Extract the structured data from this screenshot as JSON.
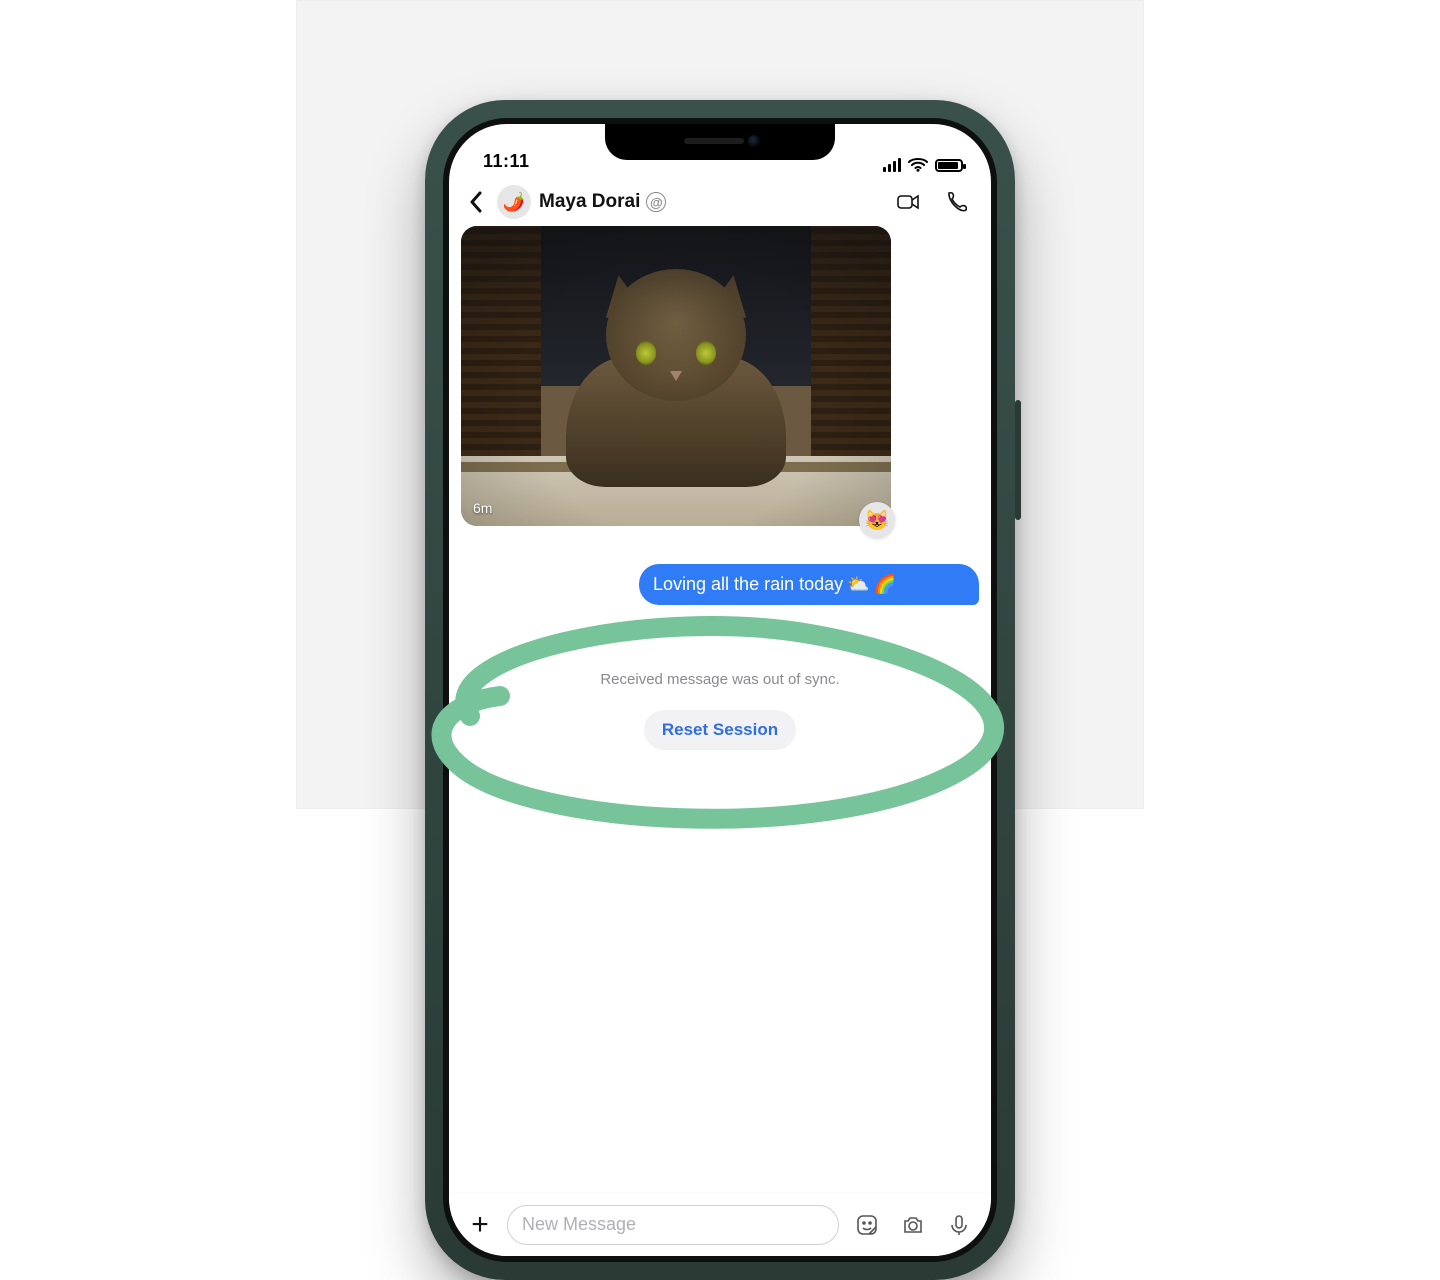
{
  "status": {
    "time": "11:11"
  },
  "header": {
    "contact_name": "Maya Dorai",
    "avatar_emoji": "🌶️",
    "at_symbol": "@"
  },
  "messages": {
    "photo_timestamp": "6m",
    "reaction_emoji": "😻",
    "outgoing_text": "Loving all the rain today",
    "outgoing_emoji_weather": "⛅",
    "outgoing_emoji_rainbow": "🌈",
    "system_notice": "Received message was out of sync.",
    "reset_button": "Reset Session"
  },
  "composer": {
    "placeholder": "New Message"
  },
  "colors": {
    "outgoing_bubble": "#2f7cf6",
    "reset_link": "#2f6fe0",
    "system_text": "#8a8a8f",
    "callout": "#77c49a"
  }
}
